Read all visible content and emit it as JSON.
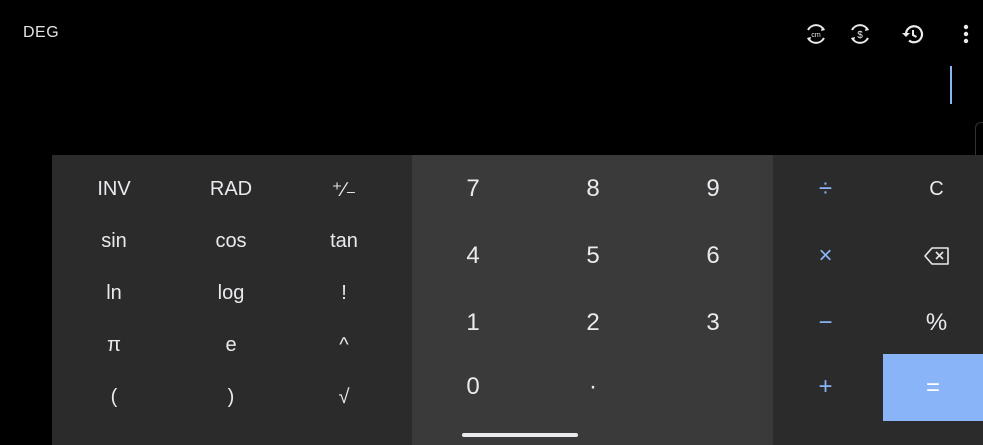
{
  "header": {
    "angle_mode": "DEG",
    "icons": [
      "unit-convert-icon",
      "currency-convert-icon",
      "history-icon",
      "more-vert-icon"
    ]
  },
  "display": {
    "expression": ""
  },
  "scientific": {
    "inv": "INV",
    "rad": "RAD",
    "plus_minus": "⁺∕₋",
    "sin": "sin",
    "cos": "cos",
    "tan": "tan",
    "ln": "ln",
    "log": "log",
    "factorial": "!",
    "pi": "π",
    "e": "e",
    "power": "^",
    "open_paren": "(",
    "close_paren": ")",
    "sqrt": "√"
  },
  "numpad": {
    "seven": "7",
    "eight": "8",
    "nine": "9",
    "four": "4",
    "five": "5",
    "six": "6",
    "one": "1",
    "two": "2",
    "three": "3",
    "zero": "0",
    "dot": "·"
  },
  "operators": {
    "divide": "÷",
    "clear": "C",
    "multiply": "×",
    "backspace_icon": "backspace-icon",
    "minus": "−",
    "percent": "%",
    "plus": "+",
    "equals": "="
  },
  "colors": {
    "accent": "#8ab4f8",
    "panel_dark": "#2b2b2b",
    "panel_mid": "#3a3a3a",
    "background": "#000000"
  }
}
